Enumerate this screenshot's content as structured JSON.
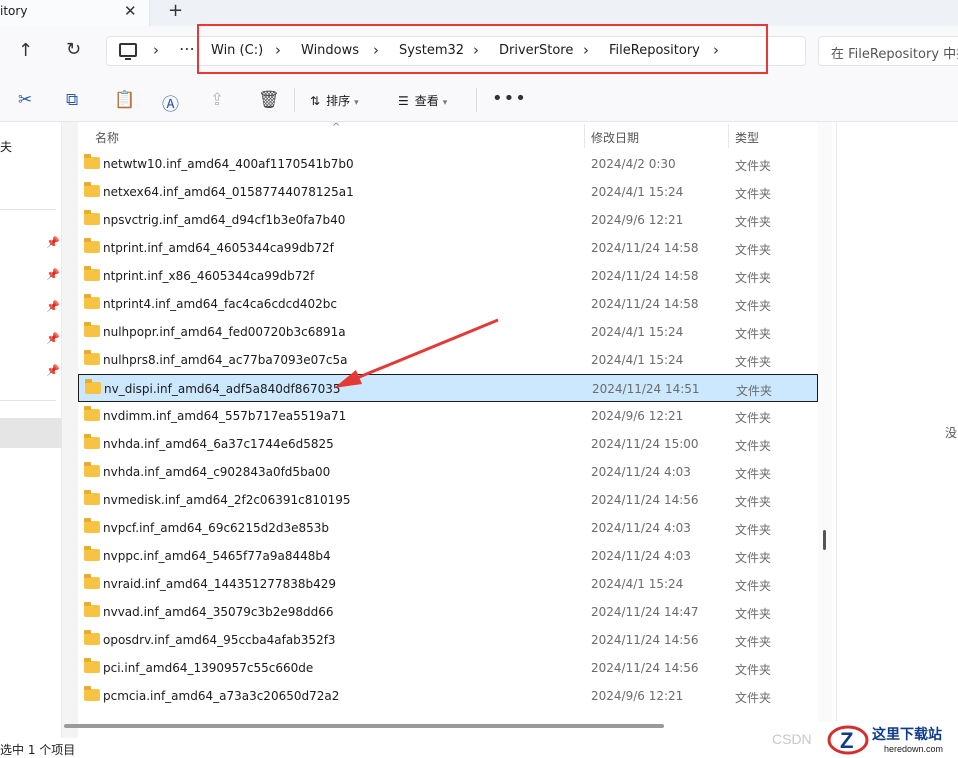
{
  "tabs": {
    "title": "itory",
    "close_icon": "✕",
    "new_icon": "+"
  },
  "address_bar": {
    "up_icon": "↑",
    "refresh_icon": "↻",
    "dots": "⋯",
    "breadcrumbs": [
      "Win (C:)",
      "Windows",
      "System32",
      "DriverStore",
      "FileRepository"
    ],
    "search_placeholder": "在 FileRepository 中搜"
  },
  "toolbar": {
    "cut_icon": "✂",
    "copy_icon": "⧉",
    "paste_icon": "📋",
    "rename_icon": "Ⓐ",
    "share_icon": "⇪",
    "delete_icon": "🗑",
    "sort_label": "排序",
    "view_label": "查看",
    "more_icon": "•••"
  },
  "nav": {
    "truncated_label": "夫",
    "pin_icon": "📌"
  },
  "columns": {
    "name": "名称",
    "modified": "修改日期",
    "type": "类型"
  },
  "files": [
    {
      "name": "netwtw10.inf_amd64_400af1170541b7b0",
      "date": "2024/4/2 0:30",
      "type": "文件夹"
    },
    {
      "name": "netxex64.inf_amd64_01587744078125a1",
      "date": "2024/4/1 15:24",
      "type": "文件夹"
    },
    {
      "name": "npsvctrig.inf_amd64_d94cf1b3e0fa7b40",
      "date": "2024/9/6 12:21",
      "type": "文件夹"
    },
    {
      "name": "ntprint.inf_amd64_4605344ca99db72f",
      "date": "2024/11/24 14:58",
      "type": "文件夹"
    },
    {
      "name": "ntprint.inf_x86_4605344ca99db72f",
      "date": "2024/11/24 14:58",
      "type": "文件夹"
    },
    {
      "name": "ntprint4.inf_amd64_fac4ca6cdcd402bc",
      "date": "2024/11/24 14:58",
      "type": "文件夹"
    },
    {
      "name": "nulhpopr.inf_amd64_fed00720b3c6891a",
      "date": "2024/4/1 15:24",
      "type": "文件夹"
    },
    {
      "name": "nulhprs8.inf_amd64_ac77ba7093e07c5a",
      "date": "2024/4/1 15:24",
      "type": "文件夹"
    },
    {
      "name": "nv_dispi.inf_amd64_adf5a840df867035",
      "date": "2024/11/24 14:51",
      "type": "文件夹"
    },
    {
      "name": "nvdimm.inf_amd64_557b717ea5519a71",
      "date": "2024/9/6 12:21",
      "type": "文件夹"
    },
    {
      "name": "nvhda.inf_amd64_6a37c1744e6d5825",
      "date": "2024/11/24 15:00",
      "type": "文件夹"
    },
    {
      "name": "nvhda.inf_amd64_c902843a0fd5ba00",
      "date": "2024/11/24 4:03",
      "type": "文件夹"
    },
    {
      "name": "nvmedisk.inf_amd64_2f2c06391c810195",
      "date": "2024/11/24 14:56",
      "type": "文件夹"
    },
    {
      "name": "nvpcf.inf_amd64_69c6215d2d3e853b",
      "date": "2024/11/24 4:03",
      "type": "文件夹"
    },
    {
      "name": "nvppc.inf_amd64_5465f77a9a8448b4",
      "date": "2024/11/24 4:03",
      "type": "文件夹"
    },
    {
      "name": "nvraid.inf_amd64_144351277838b429",
      "date": "2024/4/1 15:24",
      "type": "文件夹"
    },
    {
      "name": "nvvad.inf_amd64_35079c3b2e98dd66",
      "date": "2024/11/24 14:47",
      "type": "文件夹"
    },
    {
      "name": "oposdrv.inf_amd64_95ccba4afab352f3",
      "date": "2024/11/24 14:56",
      "type": "文件夹"
    },
    {
      "name": "pci.inf_amd64_1390957c55c660de",
      "date": "2024/11/24 14:56",
      "type": "文件夹"
    },
    {
      "name": "pcmcia.inf_amd64_a73a3c20650d72a2",
      "date": "2024/9/6 12:21",
      "type": "文件夹"
    }
  ],
  "selected_row": 8,
  "right_pane": {
    "text": "没"
  },
  "status": {
    "text": "选中 1 个项目"
  },
  "watermark": {
    "csdn": "CSDN",
    "site_title": "这里下载站",
    "site_url": "heredown.com"
  },
  "colors": {
    "highlight_red": "#e53935",
    "selection": "#cce8ff",
    "folder": "#f6c342",
    "accent_blue": "#2a5caa"
  }
}
